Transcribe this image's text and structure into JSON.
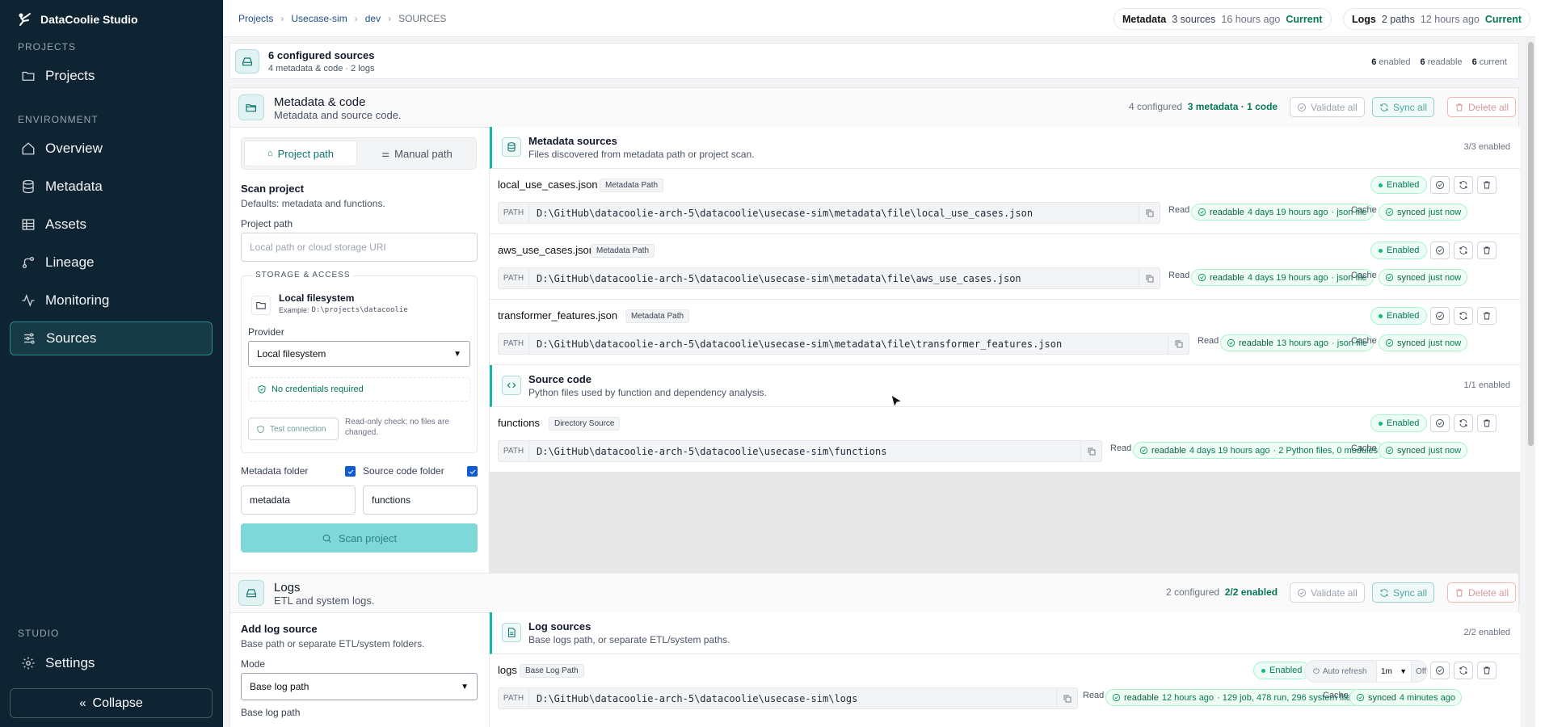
{
  "app": {
    "name": "DataCoolie Studio"
  },
  "sidebar": {
    "section_projects": "PROJECTS",
    "projects": "Projects",
    "section_environment": "ENVIRONMENT",
    "items": [
      "Overview",
      "Metadata",
      "Assets",
      "Lineage",
      "Monitoring",
      "Sources"
    ],
    "section_studio": "STUDIO",
    "settings": "Settings",
    "collapse": "Collapse"
  },
  "breadcrumb": [
    "Projects",
    "Usecase-sim",
    "dev",
    "SOURCES"
  ],
  "header_pills": {
    "metadata": {
      "label": "Metadata",
      "count": "3 sources",
      "time": "16 hours ago",
      "status": "Current"
    },
    "logs": {
      "label": "Logs",
      "count": "2 paths",
      "time": "12 hours ago",
      "status": "Current"
    }
  },
  "summary": {
    "title": "6 configured sources",
    "sub": "4 metadata & code · 2 logs",
    "enabled_n": "6",
    "enabled": "enabled",
    "readable_n": "6",
    "readable": "readable",
    "current_n": "6",
    "current": "current"
  },
  "metadata_section": {
    "title": "Metadata & code",
    "sub": "Metadata and source code.",
    "configured": "4 configured",
    "summary": "3 metadata · 1 code",
    "validate": "Validate all",
    "sync": "Sync all",
    "delete": "Delete all"
  },
  "scan_panel": {
    "tab_project": "Project path",
    "tab_manual": "Manual path",
    "title": "Scan project",
    "sub": "Defaults: metadata and functions.",
    "project_path_label": "Project path",
    "project_path_placeholder": "Local path or cloud storage URI",
    "storage_label": "STORAGE & ACCESS",
    "storage_title": "Local filesystem",
    "storage_example_prefix": "Example:",
    "storage_example": "D:\\projects\\datacoolie",
    "provider_label": "Provider",
    "provider_value": "Local filesystem",
    "credentials": "No credentials required",
    "test_button": "Test connection",
    "test_note": "Read-only check; no files are changed.",
    "metadata_folder_label": "Metadata folder",
    "source_folder_label": "Source code folder",
    "metadata_folder_value": "metadata",
    "source_folder_value": "functions",
    "scan_button": "Scan project"
  },
  "metadata_sources": {
    "title": "Metadata sources",
    "sub": "Files discovered from metadata path or project scan.",
    "count": "3/3 enabled",
    "rows": [
      {
        "name": "local_use_cases.json",
        "tag": "Metadata Path",
        "status": "Enabled",
        "path_label": "PATH",
        "path": "D:\\GitHub\\datacoolie-arch-5\\datacoolie\\usecase-sim\\metadata\\file\\local_use_cases.json",
        "read": "Read",
        "readable": "readable",
        "read_time": "4 days 19 hours ago",
        "read_info": "· json file",
        "cache": "Cache",
        "synced": "synced",
        "sync_time": "just now"
      },
      {
        "name": "aws_use_cases.json",
        "tag": "Metadata Path",
        "status": "Enabled",
        "path_label": "PATH",
        "path": "D:\\GitHub\\datacoolie-arch-5\\datacoolie\\usecase-sim\\metadata\\file\\aws_use_cases.json",
        "read": "Read",
        "readable": "readable",
        "read_time": "4 days 19 hours ago",
        "read_info": "· json file",
        "cache": "Cache",
        "synced": "synced",
        "sync_time": "just now"
      },
      {
        "name": "transformer_features.json",
        "tag": "Metadata Path",
        "status": "Enabled",
        "path_label": "PATH",
        "path": "D:\\GitHub\\datacoolie-arch-5\\datacoolie\\usecase-sim\\metadata\\file\\transformer_features.json",
        "read": "Read",
        "readable": "readable",
        "read_time": "13 hours ago",
        "read_info": "· json file",
        "cache": "Cache",
        "synced": "synced",
        "sync_time": "just now"
      }
    ]
  },
  "source_code": {
    "title": "Source code",
    "sub": "Python files used by function and dependency analysis.",
    "count": "1/1 enabled",
    "rows": [
      {
        "name": "functions",
        "tag": "Directory Source",
        "status": "Enabled",
        "path_label": "PATH",
        "path": "D:\\GitHub\\datacoolie-arch-5\\datacoolie\\usecase-sim\\functions",
        "read": "Read",
        "readable": "readable",
        "read_time": "4 days 19 hours ago",
        "read_info": "· 2 Python files, 0 modules",
        "cache": "Cache",
        "synced": "synced",
        "sync_time": "just now"
      }
    ]
  },
  "logs_section": {
    "title": "Logs",
    "sub": "ETL and system logs.",
    "configured": "2 configured",
    "summary": "2/2 enabled",
    "validate": "Validate all",
    "sync": "Sync all",
    "delete": "Delete all",
    "add_title": "Add log source",
    "add_sub": "Base path or separate ETL/system folders.",
    "mode_label": "Mode",
    "mode_value": "Base log path",
    "base_path_label": "Base log path",
    "group_title": "Log sources",
    "group_sub": "Base logs path, or separate ETL/system paths.",
    "group_count": "2/2 enabled",
    "row": {
      "name": "logs",
      "tag": "Base Log Path",
      "status": "Enabled",
      "auto_refresh": "Auto refresh",
      "interval": "1m",
      "off": "Off",
      "path_label": "PATH",
      "path": "D:\\GitHub\\datacoolie-arch-5\\datacoolie\\usecase-sim\\logs",
      "read": "Read",
      "readable": "readable",
      "read_time": "12 hours ago",
      "read_info": "· 129 job, 478 run, 296 system files",
      "cache": "Cache",
      "synced": "synced",
      "sync_time": "4 minutes ago"
    }
  },
  "colors": {
    "sidebar": "#0e2432",
    "accent": "#14b8a6",
    "success": "#047857"
  }
}
